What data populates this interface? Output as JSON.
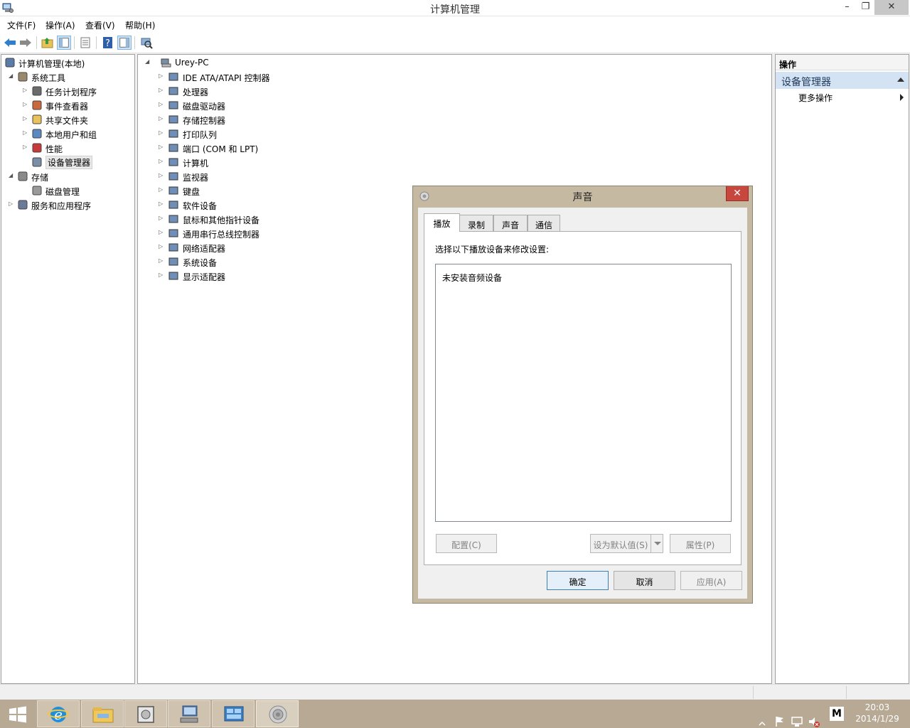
{
  "window": {
    "title": "计算机管理",
    "minimize_glyph": "–",
    "maximize_glyph": "❐",
    "close_glyph": "✕"
  },
  "menu": [
    "文件(F)",
    "操作(A)",
    "查看(V)",
    "帮助(H)"
  ],
  "toolbar_icons": [
    "back-icon",
    "forward-icon",
    "up-folder-icon",
    "show-hide-tree-icon",
    "export-list-icon",
    "help-icon",
    "show-hide-action-pane-icon",
    "scan-hardware-icon"
  ],
  "left_tree": [
    {
      "label": "计算机管理(本地)",
      "icon": "computer-management-icon",
      "level": 0,
      "expander": ""
    },
    {
      "label": "系统工具",
      "icon": "system-tools-icon",
      "level": 1,
      "expander": "◢"
    },
    {
      "label": "任务计划程序",
      "icon": "clock-icon",
      "level": 2,
      "expander": "▷"
    },
    {
      "label": "事件查看器",
      "icon": "event-viewer-icon",
      "level": 2,
      "expander": "▷"
    },
    {
      "label": "共享文件夹",
      "icon": "shared-folder-icon",
      "level": 2,
      "expander": "▷"
    },
    {
      "label": "本地用户和组",
      "icon": "users-icon",
      "level": 2,
      "expander": "▷"
    },
    {
      "label": "性能",
      "icon": "performance-icon",
      "level": 2,
      "expander": "▷"
    },
    {
      "label": "设备管理器",
      "icon": "device-manager-icon",
      "level": 2,
      "expander": "",
      "selected": true
    },
    {
      "label": "存储",
      "icon": "storage-icon",
      "level": 1,
      "expander": "◢"
    },
    {
      "label": "磁盘管理",
      "icon": "disk-management-icon",
      "level": 2,
      "expander": ""
    },
    {
      "label": "服务和应用程序",
      "icon": "services-icon",
      "level": 1,
      "expander": "▷"
    }
  ],
  "device_tree": {
    "root": "Urey-PC",
    "root_expander": "◢",
    "categories": [
      {
        "label": "IDE ATA/ATAPI 控制器",
        "icon": "ide-controller-icon"
      },
      {
        "label": "处理器",
        "icon": "processor-icon"
      },
      {
        "label": "磁盘驱动器",
        "icon": "disk-drive-icon"
      },
      {
        "label": "存储控制器",
        "icon": "storage-controller-icon"
      },
      {
        "label": "打印队列",
        "icon": "printer-icon"
      },
      {
        "label": "端口 (COM 和 LPT)",
        "icon": "port-icon"
      },
      {
        "label": "计算机",
        "icon": "computer-icon"
      },
      {
        "label": "监视器",
        "icon": "monitor-icon"
      },
      {
        "label": "键盘",
        "icon": "keyboard-icon"
      },
      {
        "label": "软件设备",
        "icon": "software-device-icon"
      },
      {
        "label": "鼠标和其他指针设备",
        "icon": "mouse-icon"
      },
      {
        "label": "通用串行总线控制器",
        "icon": "usb-icon"
      },
      {
        "label": "网络适配器",
        "icon": "network-adapter-icon"
      },
      {
        "label": "系统设备",
        "icon": "system-device-icon"
      },
      {
        "label": "显示适配器",
        "icon": "display-adapter-icon"
      }
    ]
  },
  "actions": {
    "header": "操作",
    "group": "设备管理器",
    "item": "更多操作"
  },
  "dialog": {
    "title": "声音",
    "close_glyph": "✕",
    "tabs": [
      "播放",
      "录制",
      "声音",
      "通信"
    ],
    "active_tab": "播放",
    "instruction": "选择以下播放设备来修改设置:",
    "empty_message": "未安装音频设备",
    "configure_button": "配置(C)",
    "set_default_button": "设为默认值(S)",
    "properties_button": "属性(P)",
    "ok_button": "确定",
    "cancel_button": "取消",
    "apply_button": "应用(A)"
  },
  "taskbar": {
    "buttons": [
      "start-icon",
      "internet-explorer-icon",
      "file-explorer-icon",
      "disk-image-icon",
      "computer-management-taskbar-icon",
      "control-panel-icon",
      "sound-taskbar-icon"
    ],
    "tray_icons": [
      "show-hidden-icons-icon",
      "action-center-flag-icon",
      "network-icon",
      "volume-muted-icon",
      "input-method-icon"
    ],
    "input_method_label": "M",
    "time": "20:03",
    "date": "2014/1/29"
  },
  "colors": {
    "taskbar": "#b7a994",
    "dialog_frame": "#c6b9a2",
    "close_button": "#c7463e",
    "action_group": "#d4e3f4"
  }
}
